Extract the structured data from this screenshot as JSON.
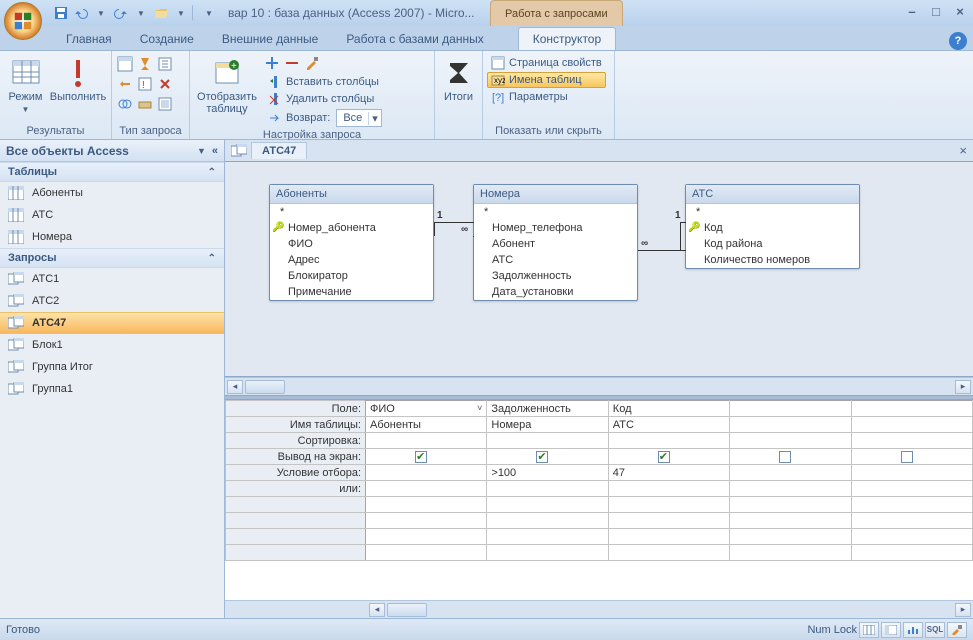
{
  "title": "вар 10 : база данных (Access 2007) - Micro...",
  "context_tab": "Работа с запросами",
  "tabs": [
    "Главная",
    "Создание",
    "Внешние данные",
    "Работа с базами данных",
    "Конструктор"
  ],
  "ribbon": {
    "g1": {
      "label": "Результаты",
      "mode": "Режим",
      "run": "Выполнить"
    },
    "g2": {
      "label": "Тип запроса"
    },
    "g3": {
      "label": "Настройка запроса",
      "show_table": "Отобразить\nтаблицу",
      "insert_cols": "Вставить столбцы",
      "delete_cols": "Удалить столбцы",
      "return": "Возврат:",
      "return_val": "Все"
    },
    "g4": {
      "label": "",
      "totals": "Итоги"
    },
    "g5": {
      "label": "Показать или скрыть",
      "prop": "Страница свойств",
      "tnames": "Имена таблиц",
      "params": "Параметры"
    }
  },
  "nav": {
    "header": "Все объекты Access",
    "groups": [
      {
        "title": "Таблицы",
        "items": [
          "Абоненты",
          "АТС",
          "Номера"
        ]
      },
      {
        "title": "Запросы",
        "items": [
          "АТС1",
          "АТС2",
          "АТС47",
          "Блок1",
          "Группа Итог",
          "Группа1"
        ],
        "selected": "АТС47"
      }
    ]
  },
  "doc_tab": "АТС47",
  "tables": [
    {
      "name": "Абоненты",
      "key": "Номер_абонента",
      "fields": [
        "*",
        "Номер_абонента",
        "ФИО",
        "Адрес",
        "Блокиратор",
        "Примечание"
      ]
    },
    {
      "name": "Номера",
      "fields": [
        "*",
        "Номер_телефона",
        "Абонент",
        "АТС",
        "Задолженность",
        "Дата_установки"
      ]
    },
    {
      "name": "АТС",
      "key": "Код",
      "fields": [
        "*",
        "Код",
        "Код района",
        "Количество номеров"
      ]
    }
  ],
  "grid": {
    "row_labels": [
      "Поле:",
      "Имя таблицы:",
      "Сортировка:",
      "Вывод на экран:",
      "Условие отбора:",
      "или:"
    ],
    "cols": [
      {
        "field": "ФИО",
        "table": "Абоненты",
        "show": true,
        "crit": "",
        "dropdown": true
      },
      {
        "field": "Задолженность",
        "table": "Номера",
        "show": true,
        "crit": ">100"
      },
      {
        "field": "Код",
        "table": "АТС",
        "show": true,
        "crit": "47"
      },
      {
        "field": "",
        "table": "",
        "show": false,
        "crit": ""
      },
      {
        "field": "",
        "table": "",
        "show": false,
        "crit": ""
      }
    ]
  },
  "status": {
    "left": "Готово",
    "right": "Num Lock",
    "sql": "SQL"
  }
}
